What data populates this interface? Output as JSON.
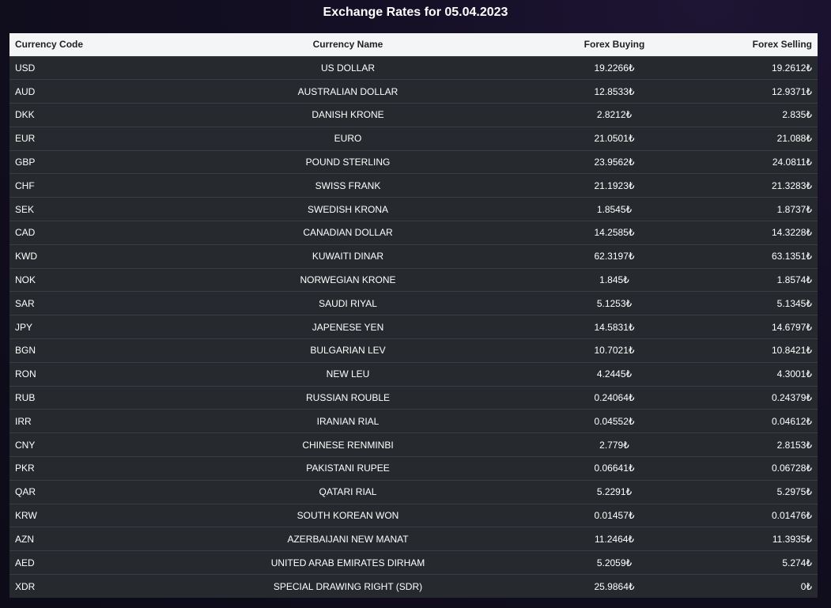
{
  "title": "Exchange Rates for 05.04.2023",
  "columns": {
    "code": "Currency Code",
    "name": "Currency Name",
    "buy": "Forex Buying",
    "sell": "Forex Selling"
  },
  "rows": [
    {
      "code": "USD",
      "name": "US DOLLAR",
      "buy": "19.2266₺",
      "sell": "19.2612₺"
    },
    {
      "code": "AUD",
      "name": "AUSTRALIAN DOLLAR",
      "buy": "12.8533₺",
      "sell": "12.9371₺"
    },
    {
      "code": "DKK",
      "name": "DANISH KRONE",
      "buy": "2.8212₺",
      "sell": "2.835₺"
    },
    {
      "code": "EUR",
      "name": "EURO",
      "buy": "21.0501₺",
      "sell": "21.088₺"
    },
    {
      "code": "GBP",
      "name": "POUND STERLING",
      "buy": "23.9562₺",
      "sell": "24.0811₺"
    },
    {
      "code": "CHF",
      "name": "SWISS FRANK",
      "buy": "21.1923₺",
      "sell": "21.3283₺"
    },
    {
      "code": "SEK",
      "name": "SWEDISH KRONA",
      "buy": "1.8545₺",
      "sell": "1.8737₺"
    },
    {
      "code": "CAD",
      "name": "CANADIAN DOLLAR",
      "buy": "14.2585₺",
      "sell": "14.3228₺"
    },
    {
      "code": "KWD",
      "name": "KUWAITI DINAR",
      "buy": "62.3197₺",
      "sell": "63.1351₺"
    },
    {
      "code": "NOK",
      "name": "NORWEGIAN KRONE",
      "buy": "1.845₺",
      "sell": "1.8574₺"
    },
    {
      "code": "SAR",
      "name": "SAUDI RIYAL",
      "buy": "5.1253₺",
      "sell": "5.1345₺"
    },
    {
      "code": "JPY",
      "name": "JAPENESE YEN",
      "buy": "14.5831₺",
      "sell": "14.6797₺"
    },
    {
      "code": "BGN",
      "name": "BULGARIAN LEV",
      "buy": "10.7021₺",
      "sell": "10.8421₺"
    },
    {
      "code": "RON",
      "name": "NEW LEU",
      "buy": "4.2445₺",
      "sell": "4.3001₺"
    },
    {
      "code": "RUB",
      "name": "RUSSIAN ROUBLE",
      "buy": "0.24064₺",
      "sell": "0.24379₺"
    },
    {
      "code": "IRR",
      "name": "IRANIAN RIAL",
      "buy": "0.04552₺",
      "sell": "0.04612₺"
    },
    {
      "code": "CNY",
      "name": "CHINESE RENMINBI",
      "buy": "2.779₺",
      "sell": "2.8153₺"
    },
    {
      "code": "PKR",
      "name": "PAKISTANI RUPEE",
      "buy": "0.06641₺",
      "sell": "0.06728₺"
    },
    {
      "code": "QAR",
      "name": "QATARI RIAL",
      "buy": "5.2291₺",
      "sell": "5.2975₺"
    },
    {
      "code": "KRW",
      "name": "SOUTH KOREAN WON",
      "buy": "0.01457₺",
      "sell": "0.01476₺"
    },
    {
      "code": "AZN",
      "name": "AZERBAIJANI NEW MANAT",
      "buy": "11.2464₺",
      "sell": "11.3935₺"
    },
    {
      "code": "AED",
      "name": "UNITED ARAB EMIRATES DIRHAM",
      "buy": "5.2059₺",
      "sell": "5.274₺"
    },
    {
      "code": "XDR",
      "name": "SPECIAL DRAWING RIGHT (SDR)",
      "buy": "25.9864₺",
      "sell": "0₺"
    }
  ]
}
